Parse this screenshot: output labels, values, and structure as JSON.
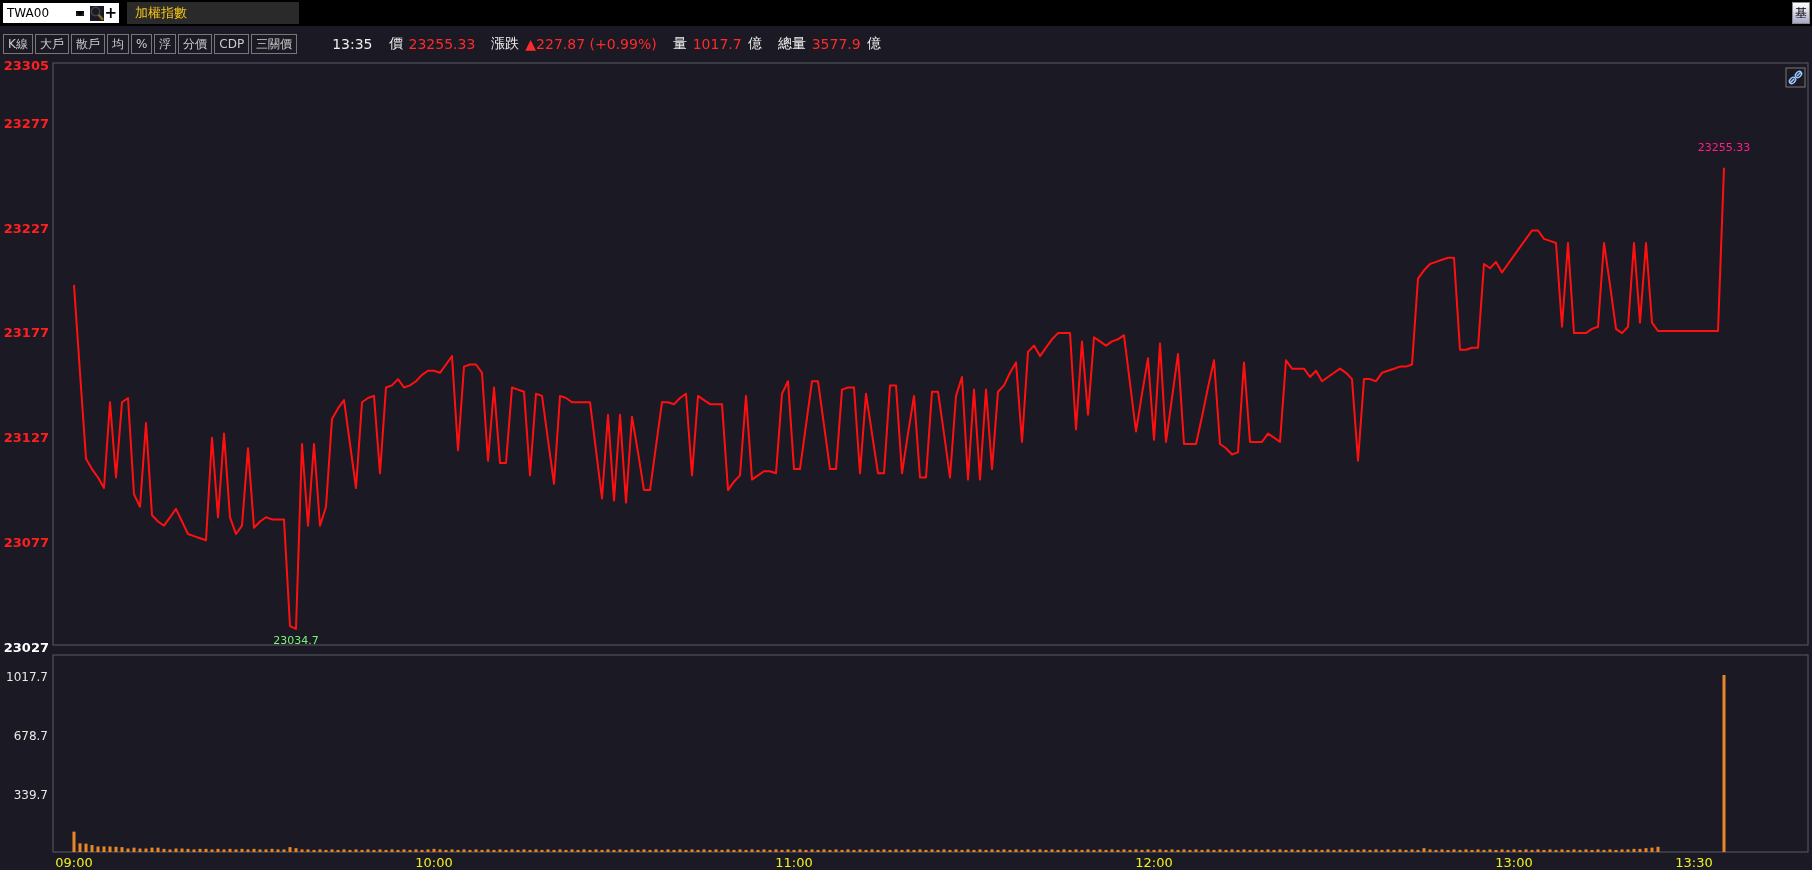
{
  "symbol_box": {
    "value": "TWA00",
    "add": "+"
  },
  "title_tab": {
    "label": "加權指數"
  },
  "side_button": {
    "label": "基"
  },
  "toolbar": [
    "K線",
    "大戶",
    "散戶",
    "均",
    "%",
    "浮",
    "分價",
    "CDP",
    "三關價"
  ],
  "quote": {
    "time": "13:35",
    "price_label": "價",
    "price": "23255.33",
    "change_label": "漲跌",
    "change": "▲227.87 (+0.99%)",
    "volume_label": "量",
    "volume": "1017.7",
    "volume_unit": "億",
    "total_label": "總量",
    "total": "3577.9",
    "total_unit": "億"
  },
  "price_chart": {
    "chart_data": {
      "type": "line",
      "categories": [
        null,
        null,
        null,
        null,
        null,
        null,
        null,
        null,
        null,
        null,
        null,
        null,
        null,
        null,
        null,
        null,
        null,
        null,
        null,
        null,
        null,
        null,
        null,
        null,
        null,
        null,
        null,
        null,
        null,
        null,
        null,
        null,
        null,
        null,
        null,
        null,
        null,
        null,
        null,
        null,
        null,
        null,
        null,
        null,
        null,
        null,
        null,
        null,
        null,
        null,
        null,
        null,
        null,
        null,
        null,
        null,
        null,
        null,
        null,
        null,
        null,
        null,
        null,
        null,
        null,
        null,
        null,
        null,
        null,
        null,
        null,
        null,
        null,
        null,
        null,
        null,
        null,
        null,
        null,
        null,
        null,
        null,
        null,
        null,
        null,
        null,
        null,
        null,
        null,
        null,
        null,
        null,
        null,
        null,
        null,
        null,
        null,
        null,
        null,
        null,
        null,
        null,
        null,
        null,
        null,
        null,
        null,
        null,
        null,
        null,
        null,
        null,
        null,
        null,
        null,
        null,
        null,
        null,
        null,
        null,
        null,
        null,
        null,
        null,
        null,
        null,
        null,
        null,
        null,
        null,
        null,
        null,
        null,
        null,
        null,
        null,
        null,
        null,
        null,
        null,
        null,
        null,
        null,
        null,
        null,
        null,
        null,
        null,
        null,
        null,
        null,
        null,
        null,
        null,
        null,
        null,
        null,
        null,
        null,
        null,
        null,
        null,
        null,
        null,
        null,
        null,
        null,
        null,
        null,
        null,
        null,
        null,
        null,
        null,
        null,
        null,
        null,
        null,
        null,
        null,
        null,
        null,
        null,
        null,
        null,
        null,
        null,
        null,
        null,
        null,
        null,
        null,
        null,
        null,
        null,
        null,
        null,
        null,
        null,
        null,
        null,
        null,
        null,
        null,
        null,
        null,
        null,
        null,
        null,
        null,
        null,
        null,
        null,
        null,
        null,
        null,
        null,
        null,
        null,
        null,
        null,
        null,
        null,
        null,
        null,
        null,
        null,
        null,
        null,
        null,
        null,
        null,
        null,
        null,
        null,
        null,
        null,
        null,
        null,
        null,
        null,
        null,
        null,
        null,
        null,
        null,
        null,
        null,
        null,
        null,
        null,
        null,
        null,
        null,
        null,
        null,
        null,
        null,
        null,
        null,
        null,
        null,
        null,
        null,
        null,
        null,
        null,
        null,
        null,
        null,
        null,
        null,
        null,
        null,
        null,
        null
      ],
      "series": [
        {
          "color": "#ff1010",
          "values": [
            23199,
            23157,
            23116,
            23111,
            23107,
            23102,
            23143,
            23107,
            23143,
            23145,
            23099,
            23093,
            23133,
            23089,
            23086,
            23084,
            23088,
            23092,
            23086,
            23080,
            23079,
            23078,
            23077,
            23126,
            23088,
            23128,
            23088,
            23080,
            23084,
            23121,
            23083,
            23086,
            23088,
            23087,
            23087,
            23087,
            23036,
            23034.7,
            23123,
            23084,
            23123,
            23084,
            23093,
            23135,
            23140,
            23144,
            23123,
            23102,
            23143,
            23145,
            23146,
            23109,
            23150,
            23151,
            23154,
            23150,
            23151,
            23153,
            23156,
            23158,
            23158,
            23157,
            23161,
            23165,
            23120,
            23160,
            23161,
            23161,
            23157,
            23115,
            23150,
            23114,
            23114,
            23150,
            23149,
            23148,
            23108,
            23147,
            23146,
            23125,
            23104,
            23146,
            23145,
            23143,
            23143,
            23143,
            23143,
            23120,
            23097,
            23137,
            23096,
            23137,
            23095,
            23136,
            23119,
            23101,
            23101,
            23122,
            23143,
            23143,
            23142,
            23145,
            23147,
            23108,
            23146,
            23144,
            23142,
            23142,
            23142,
            23101,
            23105,
            23108,
            23146,
            23106,
            23108,
            23110,
            23110,
            23109,
            23147,
            23153,
            23111,
            23111,
            23132,
            23153,
            23153,
            23132,
            23111,
            23111,
            23149,
            23150,
            23150,
            23109,
            23147,
            23128,
            23109,
            23109,
            23151,
            23151,
            23109,
            23128,
            23146,
            23107,
            23107,
            23148,
            23148,
            23128,
            23107,
            23146,
            23155,
            23106,
            23149,
            23106,
            23149,
            23111,
            23148,
            23151,
            23157,
            23162,
            23124,
            23167,
            23170,
            23165,
            23169,
            23173,
            23176,
            23176,
            23176,
            23130,
            23172,
            23137,
            23174,
            23172,
            23170,
            23172,
            23173,
            23175,
            23152,
            23129,
            23147,
            23164,
            23125,
            23171,
            23124,
            23145,
            23166,
            23123,
            23123,
            23123,
            23136,
            23150,
            23163,
            23123,
            23121,
            23118,
            23119,
            23162,
            23124,
            23124,
            23124,
            23128,
            23126,
            23124,
            23163,
            23159,
            23159,
            23159,
            23155,
            23158,
            23153,
            23155,
            23157,
            23159,
            23157,
            23154,
            23115,
            23154,
            23154,
            23153,
            23157,
            23158,
            23159,
            23160,
            23160,
            23161,
            23202,
            23206,
            23209,
            23210,
            23211,
            23212,
            23212,
            23168,
            23168,
            23169,
            23169,
            23209,
            23207,
            23210,
            23205,
            23209,
            23213,
            23217,
            23221,
            23225,
            23225,
            23221,
            23220,
            23219,
            23179,
            23219,
            23176,
            23176,
            23176,
            23178,
            23179,
            23219,
            23199,
            23178,
            23176,
            23179,
            23219,
            23181,
            23219,
            23181,
            23177,
            23177,
            23177,
            23177,
            23177,
            23177,
            23177,
            23177,
            23177,
            23177,
            23177,
            23255
          ]
        }
      ],
      "ylim": [
        23027,
        23305
      ],
      "yticks": [
        {
          "value": 23027,
          "label": "23027"
        },
        {
          "value": 23077,
          "label": "23077"
        },
        {
          "value": 23127,
          "label": "23127"
        },
        {
          "value": 23177,
          "label": "23177"
        },
        {
          "value": 23227,
          "label": "23227"
        },
        {
          "value": 23277,
          "label": "23277"
        },
        {
          "value": 23305,
          "label": "23305"
        }
      ],
      "annotations": [
        {
          "text": "23034.7",
          "y": 23034.7
        },
        {
          "text": "23255.33",
          "y": 23255.33
        }
      ]
    }
  },
  "volume_chart": {
    "chart_data": {
      "type": "bar",
      "values": [
        117,
        50,
        48,
        40,
        32,
        32,
        32,
        30,
        28,
        20,
        25,
        20,
        20,
        25,
        25,
        18,
        15,
        20,
        20,
        18,
        15,
        18,
        18,
        15,
        18,
        15,
        18,
        15,
        18,
        15,
        18,
        15,
        15,
        18,
        15,
        15,
        28,
        22,
        15,
        15,
        12,
        15,
        12,
        15,
        12,
        15,
        12,
        15,
        12,
        15,
        12,
        15,
        12,
        15,
        12,
        15,
        12,
        15,
        12,
        15,
        18,
        15,
        12,
        15,
        12,
        15,
        12,
        15,
        12,
        15,
        12,
        15,
        12,
        15,
        12,
        15,
        12,
        15,
        12,
        15,
        12,
        15,
        12,
        15,
        12,
        15,
        12,
        15,
        12,
        15,
        12,
        15,
        12,
        15,
        12,
        15,
        12,
        15,
        12,
        15,
        12,
        15,
        12,
        15,
        12,
        15,
        12,
        15,
        12,
        15,
        12,
        15,
        12,
        15,
        12,
        15,
        12,
        15,
        12,
        15,
        12,
        15,
        12,
        15,
        12,
        15,
        12,
        15,
        12,
        15,
        12,
        15,
        12,
        15,
        12,
        15,
        12,
        15,
        12,
        15,
        12,
        15,
        12,
        15,
        12,
        15,
        12,
        15,
        12,
        15,
        12,
        15,
        12,
        15,
        12,
        15,
        12,
        15,
        12,
        15,
        12,
        15,
        12,
        15,
        12,
        15,
        12,
        15,
        12,
        15,
        12,
        15,
        12,
        15,
        12,
        15,
        12,
        15,
        12,
        15,
        12,
        15,
        12,
        15,
        12,
        15,
        12,
        15,
        12,
        15,
        12,
        15,
        12,
        15,
        12,
        15,
        12,
        15,
        12,
        15,
        12,
        15,
        12,
        15,
        12,
        15,
        12,
        15,
        12,
        15,
        12,
        15,
        12,
        15,
        12,
        15,
        12,
        15,
        12,
        15,
        12,
        15,
        12,
        15,
        12,
        22,
        15,
        12,
        15,
        12,
        15,
        12,
        15,
        12,
        15,
        12,
        15,
        12,
        15,
        12,
        15,
        12,
        15,
        12,
        15,
        12,
        15,
        12,
        15,
        12,
        15,
        12,
        15,
        12,
        15,
        12,
        15,
        12,
        15,
        15,
        18,
        18,
        22,
        25,
        30,
        0,
        0,
        0,
        0,
        0,
        0,
        0,
        0,
        0,
        0,
        1017.7
      ],
      "categories": [
        "09:00",
        null,
        null,
        null,
        null,
        null,
        null,
        null,
        null,
        null,
        null,
        null,
        null,
        null,
        null,
        null,
        null,
        null,
        null,
        null,
        null,
        null,
        null,
        null,
        null,
        null,
        null,
        null,
        null,
        null,
        null,
        null,
        null,
        null,
        null,
        null,
        null,
        null,
        null,
        null,
        null,
        null,
        null,
        null,
        null,
        null,
        null,
        null,
        null,
        null,
        null,
        null,
        null,
        null,
        null,
        null,
        null,
        null,
        null,
        null,
        "10:00",
        null,
        null,
        null,
        null,
        null,
        null,
        null,
        null,
        null,
        null,
        null,
        null,
        null,
        null,
        null,
        null,
        null,
        null,
        null,
        null,
        null,
        null,
        null,
        null,
        null,
        null,
        null,
        null,
        null,
        null,
        null,
        null,
        null,
        null,
        null,
        null,
        null,
        null,
        null,
        null,
        null,
        null,
        null,
        null,
        null,
        null,
        null,
        null,
        null,
        null,
        null,
        null,
        null,
        null,
        null,
        null,
        null,
        null,
        null,
        "11:00",
        null,
        null,
        null,
        null,
        null,
        null,
        null,
        null,
        null,
        null,
        null,
        null,
        null,
        null,
        null,
        null,
        null,
        null,
        null,
        null,
        null,
        null,
        null,
        null,
        null,
        null,
        null,
        null,
        null,
        null,
        null,
        null,
        null,
        null,
        null,
        null,
        null,
        null,
        null,
        null,
        null,
        null,
        null,
        null,
        null,
        null,
        null,
        null,
        null,
        null,
        null,
        null,
        null,
        null,
        null,
        null,
        null,
        null,
        null,
        "12:00",
        null,
        null,
        null,
        null,
        null,
        null,
        null,
        null,
        null,
        null,
        null,
        null,
        null,
        null,
        null,
        null,
        null,
        null,
        null,
        null,
        null,
        null,
        null,
        null,
        null,
        null,
        null,
        null,
        null,
        null,
        null,
        null,
        null,
        null,
        null,
        null,
        null,
        null,
        null,
        null,
        null,
        null,
        null,
        null,
        null,
        null,
        null,
        null,
        null,
        null,
        null,
        null,
        null,
        null,
        null,
        null,
        null,
        null,
        null,
        "13:00",
        null,
        null,
        null,
        null,
        null,
        null,
        null,
        null,
        null,
        null,
        null,
        null,
        null,
        null,
        null,
        null,
        null,
        null,
        null,
        null,
        null,
        null,
        null,
        null,
        null,
        null,
        null,
        null,
        null,
        "13:30",
        null,
        null,
        null,
        null,
        null
      ],
      "ylim": [
        0,
        1017.7
      ],
      "yticks": [
        {
          "value": 339.7,
          "label": "339.7"
        },
        {
          "value": 678.7,
          "label": "678.7"
        },
        {
          "value": 1017.7,
          "label": "1017.7"
        }
      ]
    }
  }
}
